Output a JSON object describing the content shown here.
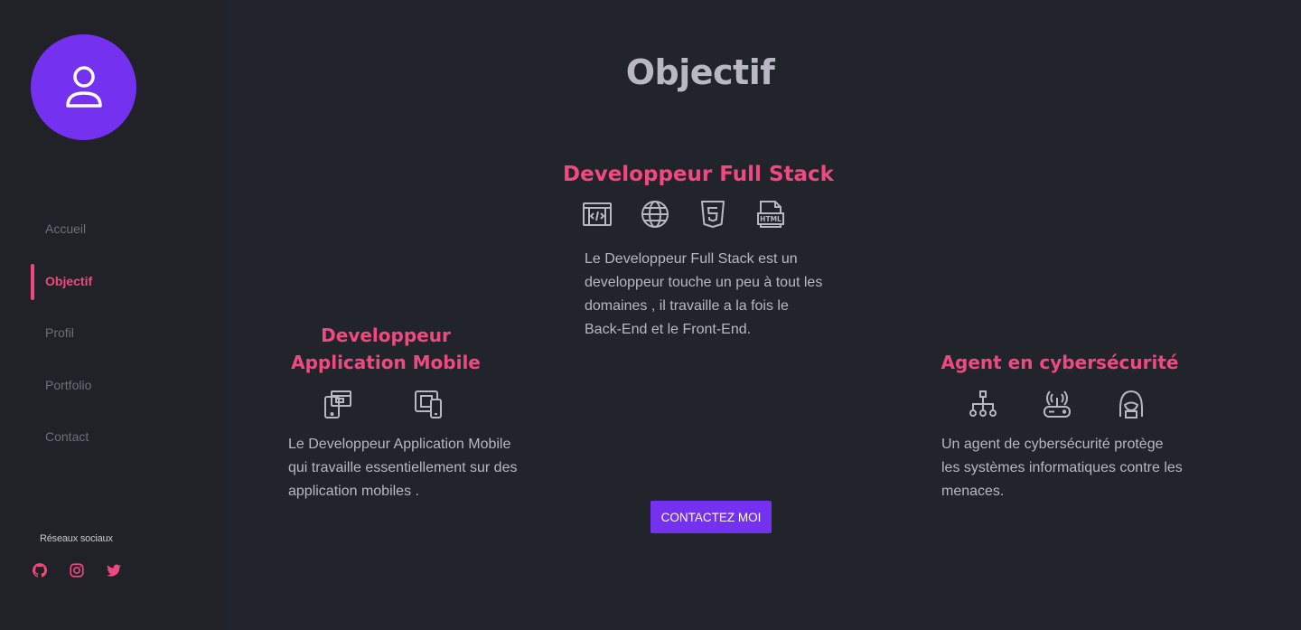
{
  "sidebar": {
    "avatar_icon": "user-icon",
    "nav": [
      "Accueil",
      "Objectif",
      "Profil",
      "Portfolio",
      "Contact"
    ],
    "active_nav": "Objectif",
    "social_title": "Réseaux sociaux",
    "social_icons": [
      "github-icon",
      "instagram-icon",
      "twitter-icon"
    ]
  },
  "main": {
    "title": "Objectif",
    "cards": [
      {
        "title": "Developpeur Full Stack",
        "icons": [
          "code-window-icon",
          "globe-icon",
          "html5-icon",
          "html-file-icon"
        ],
        "text": "Le Developpeur Full Stack est un developpeur touche un peu à tout les domaines , il travaille a la fois le Back-End et  le Front-End."
      },
      {
        "title": "Developpeur Application Mobile",
        "icons": [
          "mobile-app-icon",
          "mobile-devices-icon"
        ],
        "text": "Le Developpeur Application Mobile qui travaille essentiellement sur des application mobiles ."
      },
      {
        "title": "Agent en cybersécurité",
        "icons": [
          "network-icon",
          "router-icon",
          "hacker-icon"
        ],
        "text": "Un agent de cybersécurité protège les systèmes informatiques contre les menaces."
      }
    ],
    "contact_button": "CONTACTEZ MOI"
  },
  "colors": {
    "background": "#22242b",
    "sidebar": "#202228",
    "accent": "#f0497f",
    "purple": "#7431f0",
    "text": "#b7b8c1"
  }
}
